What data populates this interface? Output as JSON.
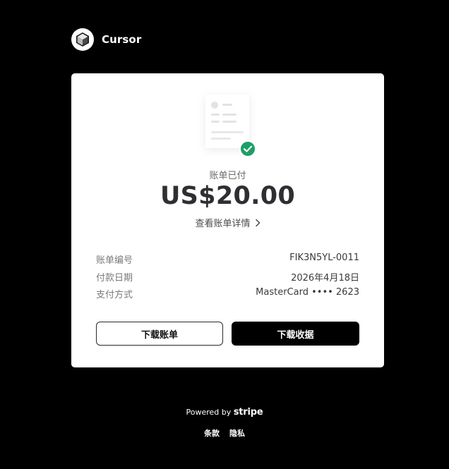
{
  "brand": {
    "name": "Cursor",
    "logo_icon": "cursor-cube-logo-icon"
  },
  "invoice": {
    "illustration_icon": "receipt-document-icon",
    "check_icon": "check-circle-icon",
    "status": "账单已付",
    "amount": "US$20.00",
    "details_link": "查看账单详情",
    "details_link_icon": "chevron-right-icon",
    "rows": [
      {
        "label": "账单编号",
        "value": "FIK3N5YL-0011"
      },
      {
        "label": "付款日期",
        "value": "2026年4月18日"
      },
      {
        "label": "支付方式",
        "value": "MasterCard •••• 2623"
      }
    ],
    "download_invoice_label": "下载账单",
    "download_receipt_label": "下载收据"
  },
  "footer": {
    "powered_by": "Powered by",
    "stripe": "stripe",
    "terms": "条款",
    "privacy": "隐私"
  },
  "colors": {
    "background": "#000000",
    "card": "#ffffff",
    "success_green": "#1e9e68"
  }
}
